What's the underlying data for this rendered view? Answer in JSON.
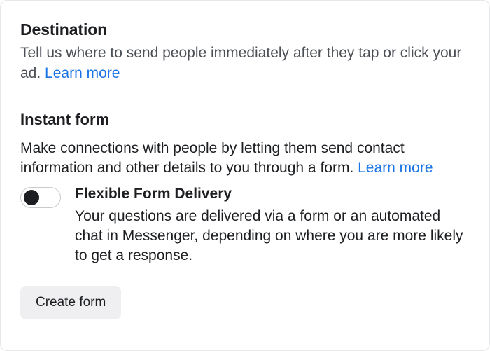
{
  "destination": {
    "title": "Destination",
    "description": "Tell us where to send people immediately after they tap or click your ad.",
    "learn_more": "Learn more"
  },
  "instant_form": {
    "title": "Instant form",
    "description": "Make connections with people by letting them send contact information and other details to you through a form.",
    "learn_more": "Learn more",
    "flexible_delivery": {
      "enabled": false,
      "title": "Flexible Form Delivery",
      "description": "Your questions are delivered via a form or an automated chat in Messenger, depending on where you are more likely to get a response."
    },
    "create_button": "Create form"
  }
}
